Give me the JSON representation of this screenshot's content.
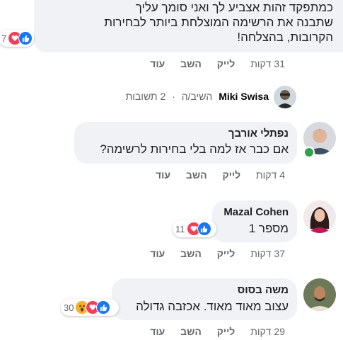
{
  "first_comment": {
    "lines": [
      "כמתפקד זהות אצביע לך ואני סומך עליך",
      "שתבנה את הרשימה המוצלחת ביותר לבחירות",
      "הקרובות, בהצלחה!"
    ],
    "reactions_count": "7",
    "time": "31 דקות",
    "like": "לייק",
    "reply": "השב",
    "more": "עוד"
  },
  "reply_summary": {
    "author": "Miki Swisa",
    "action": "השיב/ה",
    "separator": "·",
    "count_text": "2 תשובות"
  },
  "replies": [
    {
      "author": "נפתלי אורבך",
      "text": "אם כבר אז למה בלי בחירות לרשימה?",
      "time": "4 דקות",
      "like": "לייק",
      "reply": "השב",
      "more": "עוד",
      "online": true
    },
    {
      "author": "Mazal Cohen",
      "text": "מספר 1",
      "reactions_count": "11",
      "time": "37 דקות",
      "like": "לייק",
      "reply": "השב",
      "more": "עוד"
    },
    {
      "author": "משה בסוס",
      "text": "עצוב מאוד מאוד. אכזבה גדולה",
      "reactions_count": "30",
      "time": "29 דקות",
      "like": "לייק",
      "reply": "השב",
      "more": "עוד"
    }
  ],
  "colors": {
    "like_blue": "#1877f2",
    "love_red": "#f33e58",
    "wow_yellow": "#f7b125",
    "bubble_bg": "#f0f2f5",
    "meta_gray": "#65676b",
    "online_green": "#31a24c"
  }
}
